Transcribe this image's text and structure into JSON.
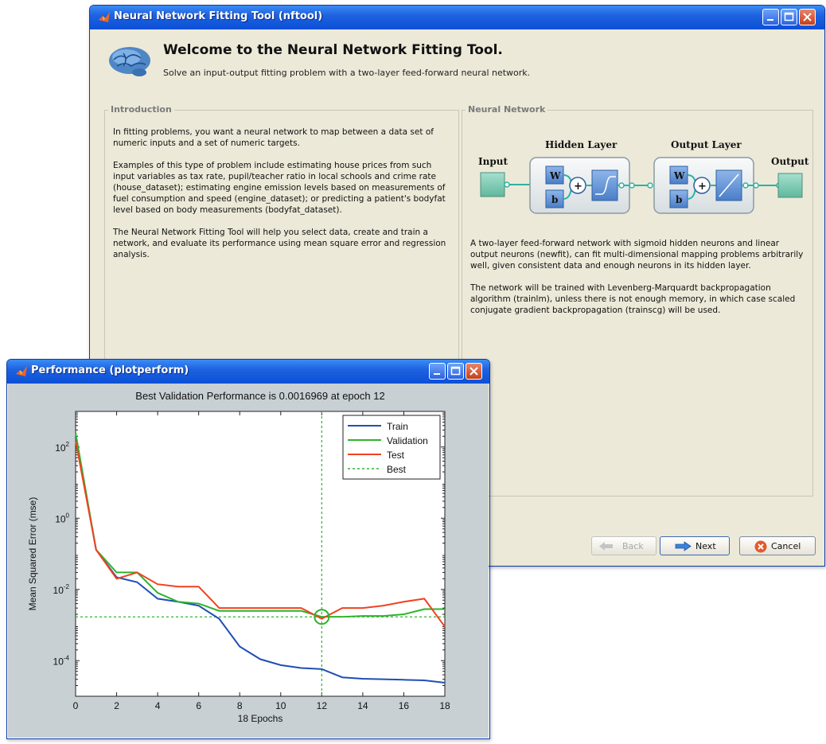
{
  "nftool": {
    "title": "Neural Network Fitting Tool (nftool)",
    "header_title": "Welcome to the Neural Network Fitting Tool.",
    "header_subtitle": "Solve an input-output fitting problem with a two-layer feed-forward neural network.",
    "intro_legend": "Introduction",
    "intro_paragraphs": [
      "In fitting problems, you want a neural network to map between a data set of numeric inputs and a set of numeric targets.",
      "Examples of this type of problem include estimating house prices from such input variables as tax rate, pupil/teacher ratio in local schools and crime rate (house_dataset); estimating engine emission levels based on measurements of fuel consumption and speed (engine_dataset); or predicting a patient's bodyfat level based on body measurements (bodyfat_dataset).",
      "The Neural Network Fitting Tool will help you select data, create and train a network, and evaluate its performance using mean square error and regression analysis."
    ],
    "nn_legend": "Neural Network",
    "diagram": {
      "input_label": "Input",
      "output_label": "Output",
      "hidden_label": "Hidden Layer",
      "output_layer_label": "Output Layer",
      "w": "W",
      "b": "b",
      "plus": "+"
    },
    "nn_paragraphs": [
      "A two-layer feed-forward network with sigmoid hidden neurons and linear output neurons (newfit), can fit multi-dimensional mapping problems arbitrarily well, given consistent data and enough neurons in its hidden layer.",
      "The network will be trained with Levenberg-Marquardt backpropagation algorithm (trainlm), unless there is not enough memory, in which case scaled conjugate gradient backpropagation (trainscg) will be used."
    ],
    "buttons": {
      "back": "Back",
      "next": "Next",
      "cancel": "Cancel"
    }
  },
  "perf": {
    "title": "Performance (plotperform)"
  },
  "icons": {
    "app": "matlab-logo-icon",
    "brain": "brain-icon",
    "minimize": "minimize-icon",
    "maximize": "maximize-icon",
    "close": "close-icon",
    "back": "back-arrow-icon",
    "next": "next-arrow-icon",
    "cancel": "cancel-icon"
  },
  "colors": {
    "train": "#1f4fb4",
    "validation": "#2db32d",
    "test": "#f0421f",
    "best": "#2db32d"
  },
  "chart_data": {
    "type": "line",
    "title": "Best Validation Performance is 0.0016969 at epoch 12",
    "xlabel": "18 Epochs",
    "ylabel": "Mean Squared Error  (mse)",
    "xlim": [
      0,
      18
    ],
    "ylim": [
      1e-05,
      1000
    ],
    "yscale": "log",
    "xticks": [
      "0",
      "2",
      "4",
      "6",
      "8",
      "10",
      "12",
      "14",
      "16",
      "18"
    ],
    "yticks": [
      {
        "base": "10",
        "exp": "2",
        "value": 100
      },
      {
        "base": "10",
        "exp": "0",
        "value": 1
      },
      {
        "base": "10",
        "exp": "-2",
        "value": 0.01
      },
      {
        "base": "10",
        "exp": "-4",
        "value": 0.0001
      }
    ],
    "legend_position": "top-right",
    "x": [
      0,
      1,
      2,
      3,
      4,
      5,
      6,
      7,
      8,
      9,
      10,
      11,
      12,
      13,
      14,
      15,
      16,
      17,
      18
    ],
    "series": [
      {
        "name": "Train",
        "values": [
          200,
          0.13,
          0.022,
          0.016,
          0.0055,
          0.0045,
          0.0035,
          0.0015,
          0.00025,
          0.00011,
          7.5e-05,
          6.2e-05,
          5.8e-05,
          3.4e-05,
          3.1e-05,
          3e-05,
          2.9e-05,
          2.8e-05,
          2.4e-05
        ]
      },
      {
        "name": "Validation",
        "values": [
          250,
          0.13,
          0.03,
          0.03,
          0.008,
          0.0045,
          0.004,
          0.0025,
          0.0025,
          0.0025,
          0.0025,
          0.0025,
          0.0017,
          0.0017,
          0.0018,
          0.0018,
          0.002,
          0.0028,
          0.0028
        ]
      },
      {
        "name": "Test",
        "values": [
          150,
          0.13,
          0.02,
          0.03,
          0.014,
          0.012,
          0.012,
          0.003,
          0.003,
          0.003,
          0.003,
          0.003,
          0.0015,
          0.003,
          0.003,
          0.0035,
          0.0045,
          0.0055,
          0.0009
        ]
      }
    ],
    "best": {
      "name": "Best",
      "epoch": 12,
      "value": 0.0016969
    }
  }
}
